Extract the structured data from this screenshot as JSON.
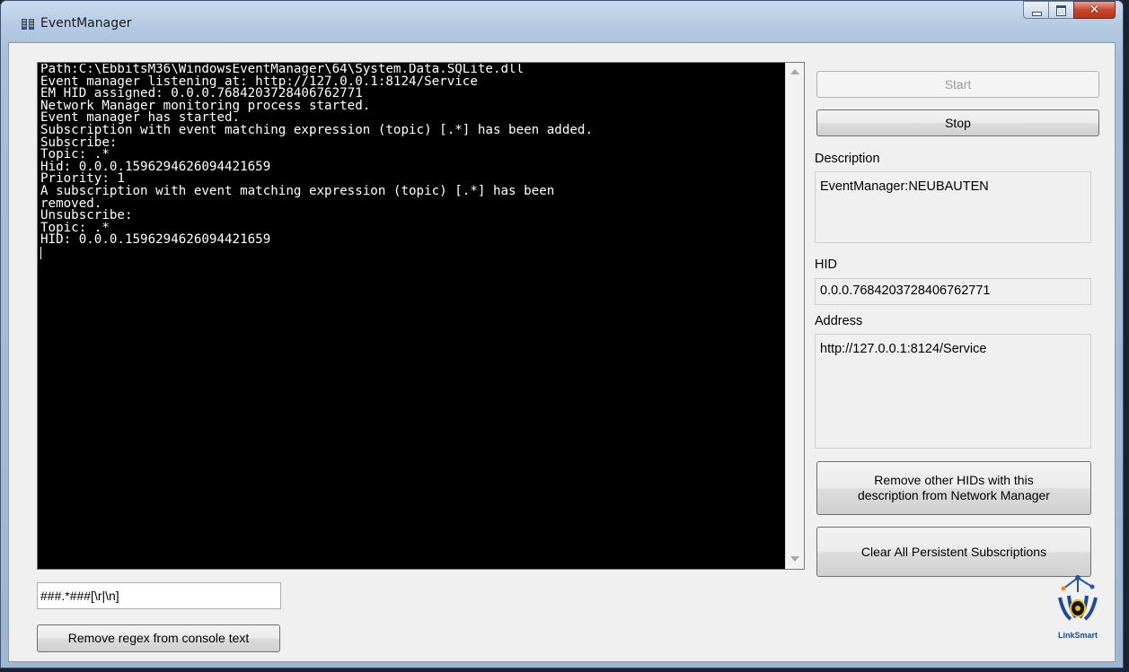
{
  "window": {
    "title": "EventManager",
    "icon": "app-icon",
    "controls": {
      "minimize": "minimize-icon",
      "maximize": "maximize-icon",
      "close": "close-icon"
    }
  },
  "console": {
    "lines": [
      "Path:C:\\EbbitsM36\\WindowsEventManager\\64\\System.Data.SQLite.dll",
      "Event manager listening at: http://127.0.0.1:8124/Service",
      "EM HID assigned: 0.0.0.7684203728406762771",
      "Network Manager monitoring process started.",
      "Event manager has started.",
      "Subscription with event matching expression (topic) [.*] has been added.",
      "Subscribe:",
      "Topic: .*",
      "Hid: 0.0.0.1596294626094421659",
      "Priority: 1",
      "A subscription with event matching expression (topic) [.*] has been",
      "removed.",
      "Unsubscribe:",
      "Topic: .*",
      "HID: 0.0.0.1596294626094421659"
    ]
  },
  "regex": {
    "value": "###.*###[\\r|\\n]",
    "remove_button": "Remove regex from console text"
  },
  "controls": {
    "start_button": "Start",
    "stop_button": "Stop",
    "description_label": "Description",
    "description_value": "EventManager:NEUBAUTEN",
    "hid_label": "HID",
    "hid_value": "0.0.0.7684203728406762771",
    "address_label": "Address",
    "address_value": "http://127.0.0.1:8124/Service",
    "remove_hids_button_line1": "Remove other HIDs with this",
    "remove_hids_button_line2": "description from Network Manager",
    "clear_button": "Clear All Persistent Subscriptions"
  },
  "logo": {
    "text": "LinkSmart",
    "icon": "linksmart-logo-icon"
  }
}
